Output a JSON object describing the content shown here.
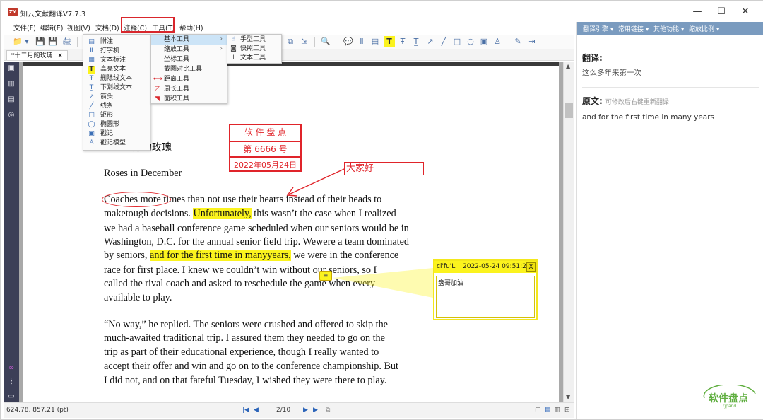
{
  "app": {
    "title": "知云文献翻译V7.7.3",
    "icon_label": "ZY"
  },
  "window_controls": {
    "minimize": "—",
    "maximize": "☐",
    "close": "✕"
  },
  "menu": {
    "items": [
      "文件(F)",
      "编辑(E)",
      "视图(V)",
      "文档(D)",
      "注释(C)",
      "工具(T)",
      "帮助(H)"
    ],
    "highlighted": [
      "注释(C)",
      "工具(T)"
    ],
    "highlight_color": "#d9262c"
  },
  "toolbar": {
    "icons": [
      "open-folder-icon",
      "dropdown-icon",
      "save-icon",
      "save-as-icon",
      "print-icon",
      "screenshot-icon",
      "select-icon",
      "zoom-icon",
      "comment-icon",
      "typewriter-icon",
      "text-callout-icon",
      "highlight-icon",
      "strikeout-icon",
      "underline-icon",
      "arrow-icon",
      "line-icon",
      "rectangle-icon",
      "ellipse-icon",
      "stamp-icon",
      "signature-icon",
      "edit-icon",
      "export-icon"
    ],
    "glyphs": [
      "📁",
      "▾",
      "💾",
      "💾",
      "🖨",
      "⧉",
      "⇲",
      "🔍",
      "💬",
      "Ⅱ",
      "▤",
      "T",
      "Ŧ",
      "T̲",
      "↗",
      "╱",
      "□",
      "○",
      "▣",
      "♙",
      "✎",
      "⇥"
    ]
  },
  "tabs": [
    {
      "label": "*十二月的玫瑰",
      "close": "×"
    }
  ],
  "dropdown_annotate": {
    "items": [
      {
        "icon": "note-icon",
        "glyph": "▤",
        "label": "附注"
      },
      {
        "icon": "typewriter-icon",
        "glyph": "Ⅱ",
        "label": "打字机"
      },
      {
        "icon": "text-callout-icon",
        "glyph": "▦",
        "label": "文本标注"
      },
      {
        "icon": "highlight-text-icon",
        "glyph": "T",
        "label": "高亮文本"
      },
      {
        "icon": "strikeout-text-icon",
        "glyph": "Ŧ",
        "label": "删除线文本"
      },
      {
        "icon": "underline-text-icon",
        "glyph": "Ṯ",
        "label": "下划线文本"
      },
      {
        "icon": "arrow-icon",
        "glyph": "↗",
        "label": "箭头"
      },
      {
        "icon": "line-icon",
        "glyph": "╱",
        "label": "线条"
      },
      {
        "icon": "rectangle-icon",
        "glyph": "□",
        "label": "矩形"
      },
      {
        "icon": "ellipse-icon",
        "glyph": "◯",
        "label": "椭圆形"
      },
      {
        "icon": "stamp-icon",
        "glyph": "▣",
        "label": "戳记"
      },
      {
        "icon": "stamp-model-icon",
        "glyph": "♙",
        "label": "戳记模型"
      }
    ]
  },
  "dropdown_tools": {
    "items": [
      {
        "icon": "basic-tools-icon",
        "glyph": "",
        "label": "基本工具",
        "submenu": true,
        "active": true
      },
      {
        "icon": "zoom-tools-icon",
        "glyph": "",
        "label": "缩放工具",
        "submenu": true,
        "active": false
      },
      {
        "icon": "coordinate-tool-icon",
        "glyph": "",
        "label": "坐标工具",
        "submenu": false,
        "active": false
      },
      {
        "icon": "screenshot-compare-icon",
        "glyph": "",
        "label": "截图对比工具",
        "submenu": false,
        "active": false
      },
      {
        "icon": "distance-tool-icon",
        "glyph": "⟷",
        "label": "距离工具",
        "submenu": false,
        "active": false
      },
      {
        "icon": "perimeter-tool-icon",
        "glyph": "◸",
        "label": "周长工具",
        "submenu": false,
        "active": false
      },
      {
        "icon": "area-tool-icon",
        "glyph": "◥",
        "label": "面积工具",
        "submenu": false,
        "active": false
      }
    ]
  },
  "dropdown_basic": {
    "items": [
      {
        "icon": "hand-tool-icon",
        "glyph": "☝",
        "label": "手型工具"
      },
      {
        "icon": "snapshot-tool-icon",
        "glyph": "◙",
        "label": "快照工具"
      },
      {
        "icon": "text-tool-icon",
        "glyph": "Ⅰ",
        "label": "文本工具"
      }
    ]
  },
  "document": {
    "heading_cn": "十二月的玫瑰",
    "heading_cn_partial": "二月的玫瑰",
    "heading_en": "Roses in December",
    "lines": [
      {
        "segments": [
          {
            "t": "Coaches more times than not use their hearts instead of their heads to",
            "hl": false
          }
        ]
      },
      {
        "segments": [
          {
            "t": "maketough  decisions.   ",
            "hl": false
          },
          {
            "t": "Unfortunately,",
            "hl": true
          },
          {
            "t": "   this   wasn’t   the case  when I  realized",
            "hl": false
          }
        ]
      },
      {
        "segments": [
          {
            "t": "we had a baseball     conference game    scheduled when our seniors would       be in",
            "hl": false
          }
        ]
      },
      {
        "segments": [
          {
            "t": "Washington,  D.C.  for  the  annual  senior  field  trip.   Wewere  a team  dominated",
            "hl": false
          }
        ]
      },
      {
        "segments": [
          {
            "t": "by seniors,   ",
            "hl": false
          },
          {
            "t": "and  for  the  first   time  in  manyyears,",
            "hl": true
          },
          {
            "t": "   we were  in  the  conference",
            "hl": false
          }
        ]
      },
      {
        "segments": [
          {
            "t": "race for first place. I knew we couldn’t win without our seniors, so I",
            "hl": false
          }
        ]
      },
      {
        "segments": [
          {
            "t": "called    the  rival    coach  and asked  to  reschedule    the  game when every",
            "hl": false
          }
        ]
      },
      {
        "segments": [
          {
            "t": "available to play.",
            "hl": false
          }
        ]
      },
      {
        "segments": [
          {
            "t": "“No way,” he replied.        The seniors were      crushed   and offered to      skip the",
            "hl": false
          }
        ]
      },
      {
        "segments": [
          {
            "t": "much-awaited traditional trip. I assured them they needed to go on the",
            "hl": false
          }
        ]
      },
      {
        "segments": [
          {
            "t": "trip as part of their educational experience, though I really wanted to",
            "hl": false
          }
        ]
      },
      {
        "segments": [
          {
            "t": "accept their offer and          win and go   on to the     conference championship. But",
            "hl": false
          }
        ]
      },
      {
        "segments": [
          {
            "t": "I  did  not,   and  on that   fateful    Tuesday,  I  wished  they  were  there   to  play.",
            "hl": false
          }
        ]
      }
    ]
  },
  "stamp": {
    "line1": "软  件  盘  点",
    "line2": "第   6666   号",
    "line3": "2022年05月24日",
    "color": "#e0242a"
  },
  "text_box": {
    "text": "大家好"
  },
  "note_popup": {
    "author": "ci'fu'L",
    "datetime": "2022-05-24 09:51:29",
    "close": "X",
    "content": "盘哥加油",
    "icon_glyph": "≡"
  },
  "statusbar": {
    "coordinates": "624.78, 857.21 (pt)",
    "page": "2/10"
  },
  "right_panel": {
    "menu": [
      "翻译引擎 ▾",
      "常用链接 ▾",
      "其他功能 ▾",
      "缩放比例 ▾"
    ],
    "translation_label": "翻译:",
    "translation_text": "这么多年来第一次",
    "original_label": "原文:",
    "original_hint": "可修改后右键重新翻译",
    "original_text": "and for the first time in many years"
  },
  "watermark": {
    "text": "软件盘点",
    "sub": "rjpand"
  },
  "colors": {
    "accent": "#7a9bbf",
    "highlight": "#fbf31e",
    "annotation_red": "#e0242a",
    "sidebar": "#3c3f57"
  }
}
